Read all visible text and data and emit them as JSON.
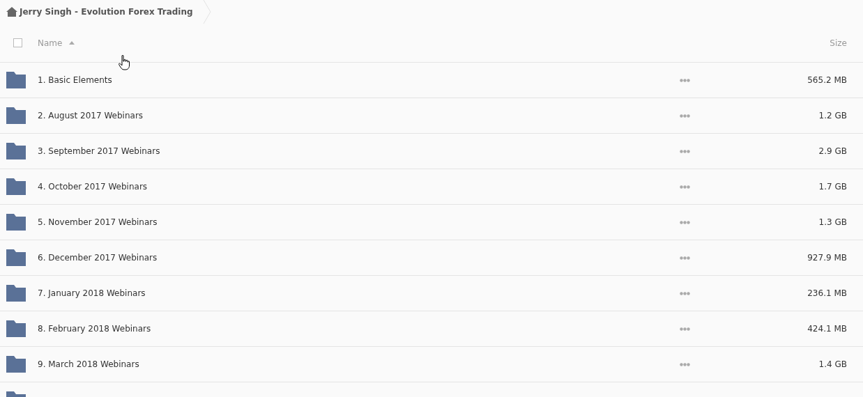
{
  "breadcrumb": {
    "title": "Jerry Singh - Evolution Forex Trading"
  },
  "table": {
    "select_all": {
      "checked": false
    },
    "columns": [
      {
        "label": "Name",
        "sorted_ascending": true
      },
      {
        "label": "Size"
      }
    ],
    "rows": [
      {
        "kind": "folder",
        "name": "1. Basic Elements",
        "size": "565.2 MB"
      },
      {
        "kind": "folder",
        "name": "2. August 2017 Webinars",
        "size": "1.2 GB"
      },
      {
        "kind": "folder",
        "name": "3. September 2017 Webinars",
        "size": "2.9 GB"
      },
      {
        "kind": "folder",
        "name": "4. October 2017 Webinars",
        "size": "1.7 GB"
      },
      {
        "kind": "folder",
        "name": "5. November 2017 Webinars",
        "size": "1.3 GB"
      },
      {
        "kind": "folder",
        "name": "6. December 2017 Webinars",
        "size": "927.9 MB"
      },
      {
        "kind": "folder",
        "name": "7. January 2018 Webinars",
        "size": "236.1 MB"
      },
      {
        "kind": "folder",
        "name": "8. February 2018 Webinars",
        "size": "424.1 MB"
      },
      {
        "kind": "folder",
        "name": "9. March 2018 Webinars",
        "size": "1.4 GB"
      },
      {
        "kind": "folder"
      }
    ]
  }
}
